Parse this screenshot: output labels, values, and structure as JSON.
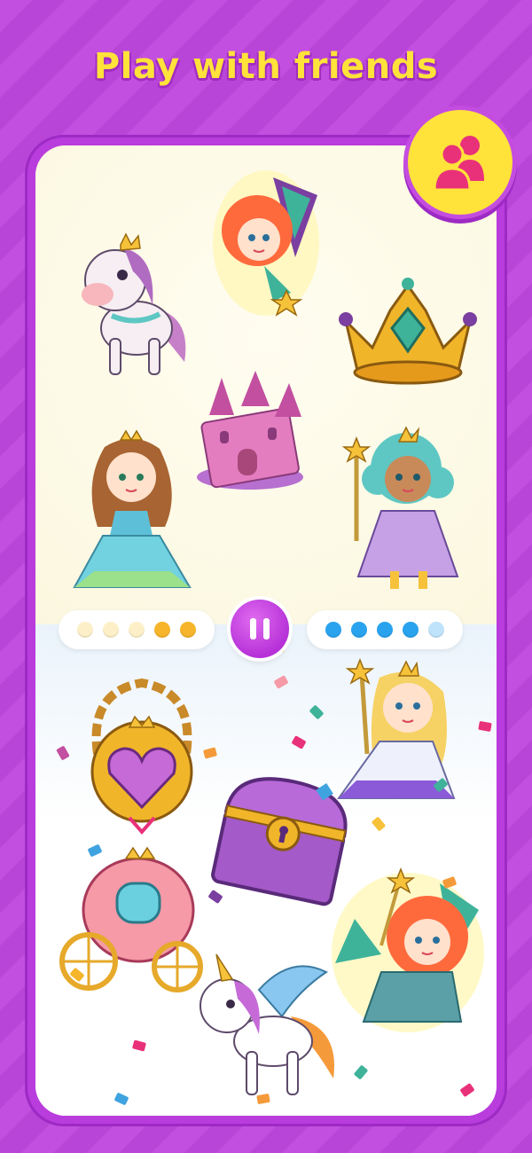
{
  "header": {
    "title": "Play with friends"
  },
  "friends_button": {
    "icon": "two-users-icon",
    "color": "#e9317a"
  },
  "controls": {
    "pause_icon": "pause-icon",
    "player_one_dots": [
      "#fdf0c8",
      "#fdf0c8",
      "#fdf0c8",
      "#f6b52a",
      "#f6b52a"
    ],
    "player_two_dots": [
      "#2aa3ef",
      "#2aa3ef",
      "#2aa3ef",
      "#2aa3ef",
      "#bfe3fb"
    ]
  },
  "top_stickers": [
    "fairy-sticker",
    "pony-sticker",
    "crown-sticker",
    "castle-sticker",
    "princess-sticker",
    "fairy-wand-sticker"
  ],
  "bottom_stickers": [
    "heart-locket-sticker",
    "wand-princess-sticker",
    "treasure-chest-sticker",
    "carriage-sticker",
    "unicorn-sticker",
    "fairy-sticker-2"
  ],
  "colors": {
    "background": "#c34fe0",
    "title": "#ffe23a",
    "accent": "#b632d8"
  }
}
